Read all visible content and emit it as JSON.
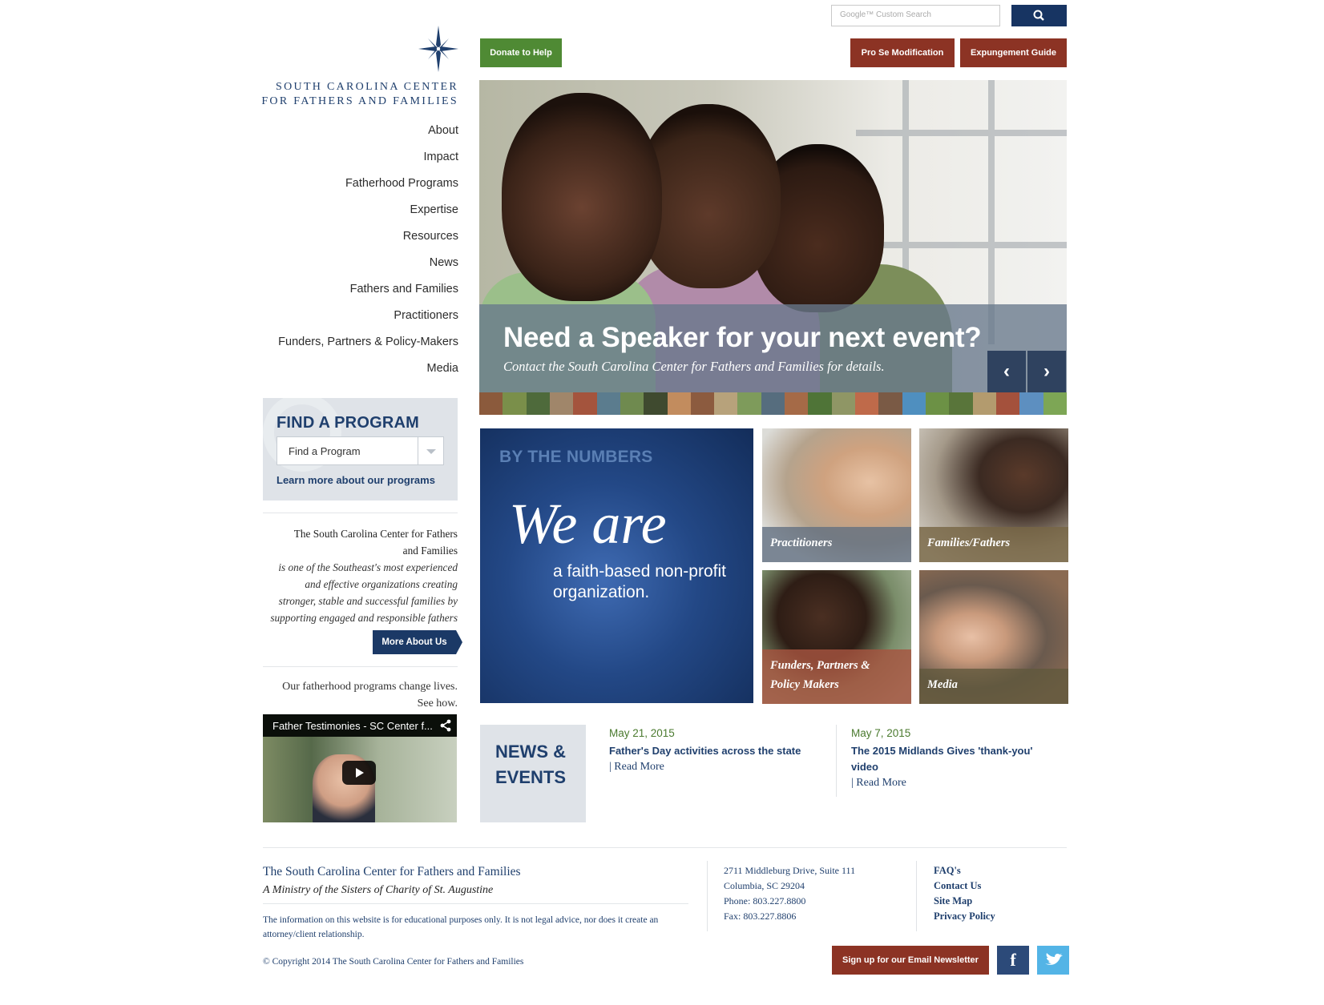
{
  "brand": {
    "logo_line1": "SOUTH CAROLINA CENTER",
    "logo_line2": "FOR FATHERS AND FAMILIES"
  },
  "nav": [
    "About",
    "Impact",
    "Fatherhood Programs",
    "Expertise",
    "Resources",
    "News",
    "Fathers and Families",
    "Practitioners",
    "Funders, Partners & Policy-Makers",
    "Media"
  ],
  "search": {
    "placeholder": "Google™ Custom Search"
  },
  "top_buttons": {
    "donate": "Donate to Help",
    "pro_se": "Pro Se Modification",
    "expungement": "Expungement Guide"
  },
  "hero": {
    "title": "Need a Speaker for your next event?",
    "subtitle": "Contact the South Carolina Center for Fathers and Families for details.",
    "prev": "‹",
    "next": "›"
  },
  "find_program": {
    "heading": "FIND A PROGRAM",
    "select_value": "Find a Program",
    "learn_more": "Learn more about our programs"
  },
  "about": {
    "lead_l1": "The South Carolina Center for Fathers",
    "lead_l2": "and Families",
    "body_l1": "is one of the Southeast's most experienced",
    "body_l2": "and effective organizations creating",
    "body_l3": "stronger, stable and successful families by",
    "body_l4": "supporting engaged and responsible fathers",
    "button": "More About Us"
  },
  "testimony": {
    "line1": "Our fatherhood programs change lives.",
    "line2": "See how.",
    "video_title": "Father Testimonies - SC Center f..."
  },
  "numbers": {
    "label": "BY THE NUMBERS",
    "big": "We are",
    "sub": "a faith-based non-profit organization."
  },
  "tiles": {
    "practitioners": "Practitioners",
    "families": "Families/Fathers",
    "funders_l1": "Funders, Partners &",
    "funders_l2": "Policy Makers",
    "media": "Media"
  },
  "news": {
    "tag_l1": "NEWS &",
    "tag_l2": "EVENTS",
    "items": [
      {
        "date": "May 21, 2015",
        "title_l1": "Father's Day activities across the state",
        "title_l2": "",
        "more": "| Read More"
      },
      {
        "date": "May 7, 2015",
        "title_l1": "The 2015 Midlands Gives 'thank-you'",
        "title_l2": "video",
        "more": "| Read More"
      }
    ]
  },
  "footer": {
    "org": "The South Carolina Center for Fathers and Families",
    "ministry": "A Ministry of the Sisters of Charity of St. Augustine",
    "disclaimer": "The information on this website is for educational purposes only. It is not legal advice, nor does it create an attorney/client relationship.",
    "copyright": "© Copyright 2014 The South Carolina Center for Fathers and Families",
    "address_l1": "2711 Middleburg Drive, Suite 111",
    "address_l2": "Columbia, SC 29204",
    "phone": "Phone: 803.227.8800",
    "fax": "Fax: 803.227.8806",
    "links": [
      "FAQ's",
      "Contact Us",
      "Site Map",
      "Privacy Policy"
    ],
    "newsletter": "Sign up for our Email Newsletter",
    "facebook": "f"
  },
  "colors": {
    "navy": "#1f3f6d",
    "green": "#4f8a34",
    "rust": "#8c3324",
    "panel": "#dfe3e8"
  },
  "icons": [
    "compass-star-icon",
    "search-icon",
    "chevron-left-icon",
    "chevron-right-icon",
    "share-icon",
    "play-icon",
    "facebook-icon",
    "twitter-icon"
  ]
}
